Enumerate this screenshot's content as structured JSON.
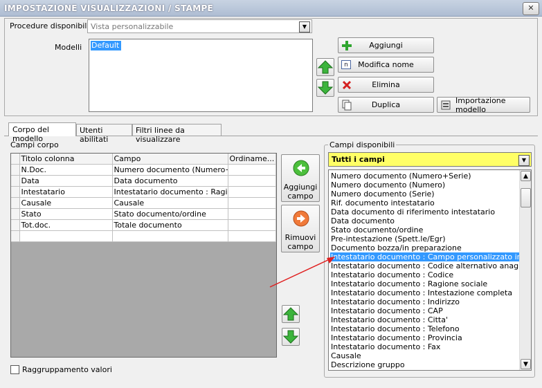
{
  "window": {
    "title": "IMPOSTAZIONE VISUALIZZAZIONI / STAMPE",
    "close": "✕"
  },
  "procedure": {
    "label": "Procedure disponibili :",
    "value": "Vista personalizzabile"
  },
  "modelli": {
    "label": "Modelli",
    "items": [
      "Default"
    ]
  },
  "buttons": {
    "aggiungi": "Aggiungi",
    "modifica_nome": "Modifica nome",
    "elimina": "Elimina",
    "duplica": "Duplica",
    "importazione": "Importazione modello"
  },
  "tabs": [
    "Corpo del modello",
    "Utenti abilitati",
    "Filtri linee da visualizzare"
  ],
  "campi_corpo": {
    "label": "Campi corpo",
    "headers": [
      "Titolo colonna",
      "Campo",
      "Ordiname..."
    ],
    "rows": [
      [
        "N.Doc.",
        "Numero documento (Numero+...",
        ""
      ],
      [
        "Data",
        "Data documento",
        ""
      ],
      [
        "Intestatario",
        "Intestatario documento : Ragi...",
        ""
      ],
      [
        "Causale",
        "Causale",
        ""
      ],
      [
        "Stato",
        "Stato documento/ordine",
        ""
      ],
      [
        "Tot.doc.",
        "Totale documento",
        ""
      ],
      [
        "",
        "",
        ""
      ]
    ]
  },
  "mid_buttons": {
    "aggiungi_campo": "Aggiungi campo",
    "rimuovi_campo": "Rimuovi campo"
  },
  "raggruppamento": {
    "label": "Raggruppamento valori"
  },
  "campi_disponibili": {
    "label": "Campi disponibili",
    "filter": "Tutti i campi",
    "items": [
      "Numero documento (Numero+Serie)",
      "Numero documento (Numero)",
      "Numero documento (Serie)",
      "Rif. documento intestatario",
      "Data documento di riferimento intestatario",
      "Data documento",
      "Stato documento/ordine",
      "Pre-intestazione (Spett.le/Egr)",
      "Documento bozza/in preparazione",
      "Intestatario documento : Campo personalizzato intestatario",
      "Intestatario documento : Codice alternativo anagrafica",
      "Intestatario documento : Codice",
      "Intestatario documento : Ragione sociale",
      "Intestatario documento : Intestazione completa",
      "Intestatario documento : Indirizzo",
      "Intestatario documento : CAP",
      "Intestatario documento : Citta'",
      "Intestatario documento : Telefono",
      "Intestatario documento : Provincia",
      "Intestatario documento : Fax",
      "Causale",
      "Descrizione gruppo"
    ],
    "selected_index": 9
  },
  "colors": {
    "accent_yellow": "#ffff66",
    "selection": "#3399ff",
    "arrow_red": "#e02020"
  }
}
